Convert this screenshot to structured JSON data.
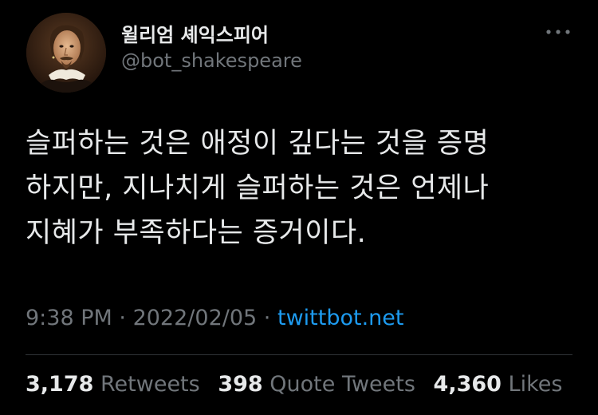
{
  "tweet": {
    "author": {
      "display_name": "윌리엄 셰익스피어",
      "handle": "@bot_shakespeare",
      "avatar_icon": "portrait-avatar"
    },
    "more_icon": "more-horizontal-icon",
    "text_lines": [
      "슬퍼하는 것은 애정이 깊다는 것을 증명",
      "하지만, 지나치게 슬퍼하는 것은 언제나",
      "지혜가 부족하다는 증거이다."
    ],
    "time": "9:38 PM",
    "date": "2022/02/05",
    "separator": "·",
    "source": "twittbot.net",
    "stats": {
      "retweets_count": "3,178",
      "retweets_label": "Retweets",
      "quotes_count": "398",
      "quotes_label": "Quote Tweets",
      "likes_count": "4,360",
      "likes_label": "Likes"
    },
    "colors": {
      "background": "#000000",
      "text": "#e7e9ea",
      "muted": "#71767b",
      "link": "#1d9bf0",
      "divider": "#2f3336"
    }
  }
}
